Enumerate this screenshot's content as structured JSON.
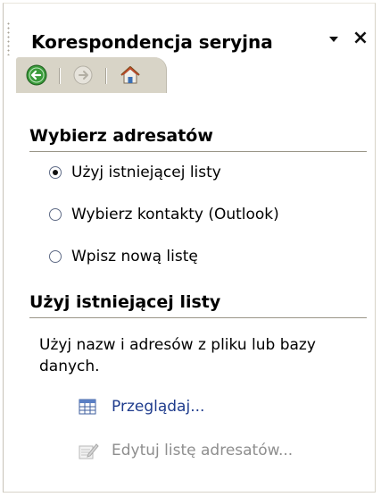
{
  "pane": {
    "title": "Korespondencja seryjna"
  },
  "nav": {
    "back_icon": "back-arrow-icon",
    "forward_icon": "forward-arrow-icon",
    "home_icon": "home-icon"
  },
  "select_recipients": {
    "header": "Wybierz adresatów",
    "options": [
      {
        "label": "Użyj istniejącej listy",
        "checked": true
      },
      {
        "label": "Wybierz kontakty (Outlook)",
        "checked": false
      },
      {
        "label": "Wpisz nową listę",
        "checked": false
      }
    ]
  },
  "existing_list": {
    "header": "Użyj istniejącej listy",
    "description": "Użyj nazw i adresów z pliku lub bazy danych.",
    "browse_label": "Przeglądaj...",
    "edit_label": "Edytuj listę adresatów..."
  },
  "colors": {
    "link": "#1f3c8d",
    "disabled": "#8e8e8e",
    "nav_bar": "#d8d4c7",
    "back_button": "#3a9a3a"
  }
}
